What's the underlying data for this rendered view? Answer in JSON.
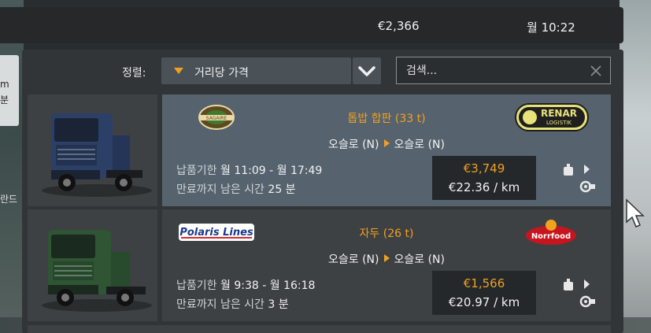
{
  "topbar": {
    "money": "€2,366",
    "clock": "월 10:22"
  },
  "sidetab": {
    "line1": "m",
    "line2": "분"
  },
  "side_text": "란드",
  "sort": {
    "label": "정렬:",
    "value": "거리당 가격"
  },
  "search": {
    "placeholder": "검색..."
  },
  "jobs": [
    {
      "cargo": "톱밥 합판 (33 t)",
      "from": "오슬로 (N)",
      "to": "오슬로 (N)",
      "deadline_label": "납품기한",
      "deadline": "월 11:09 - 월 17:49",
      "remaining_label": "만료까지 남은 시간",
      "remaining": "25 분",
      "pay": "€3,749",
      "per_km": "€22.36 / km",
      "sender_logo": "SAGAIRE",
      "receiver_logo_1": "RENAR",
      "receiver_logo_2": "LOGISTIK",
      "truck_color": "#2c3f66"
    },
    {
      "cargo": "자두 (26 t)",
      "from": "오슬로 (N)",
      "to": "오슬로 (N)",
      "deadline_label": "납품기한",
      "deadline": "월 9:38 - 월 16:18",
      "remaining_label": "만료까지 남은 시간",
      "remaining": "3 분",
      "pay": "€1,566",
      "per_km": "€20.97 / km",
      "sender_logo": "Polaris Lines",
      "receiver_logo_1": "Norrfood",
      "truck_color": "#2f5535"
    }
  ]
}
